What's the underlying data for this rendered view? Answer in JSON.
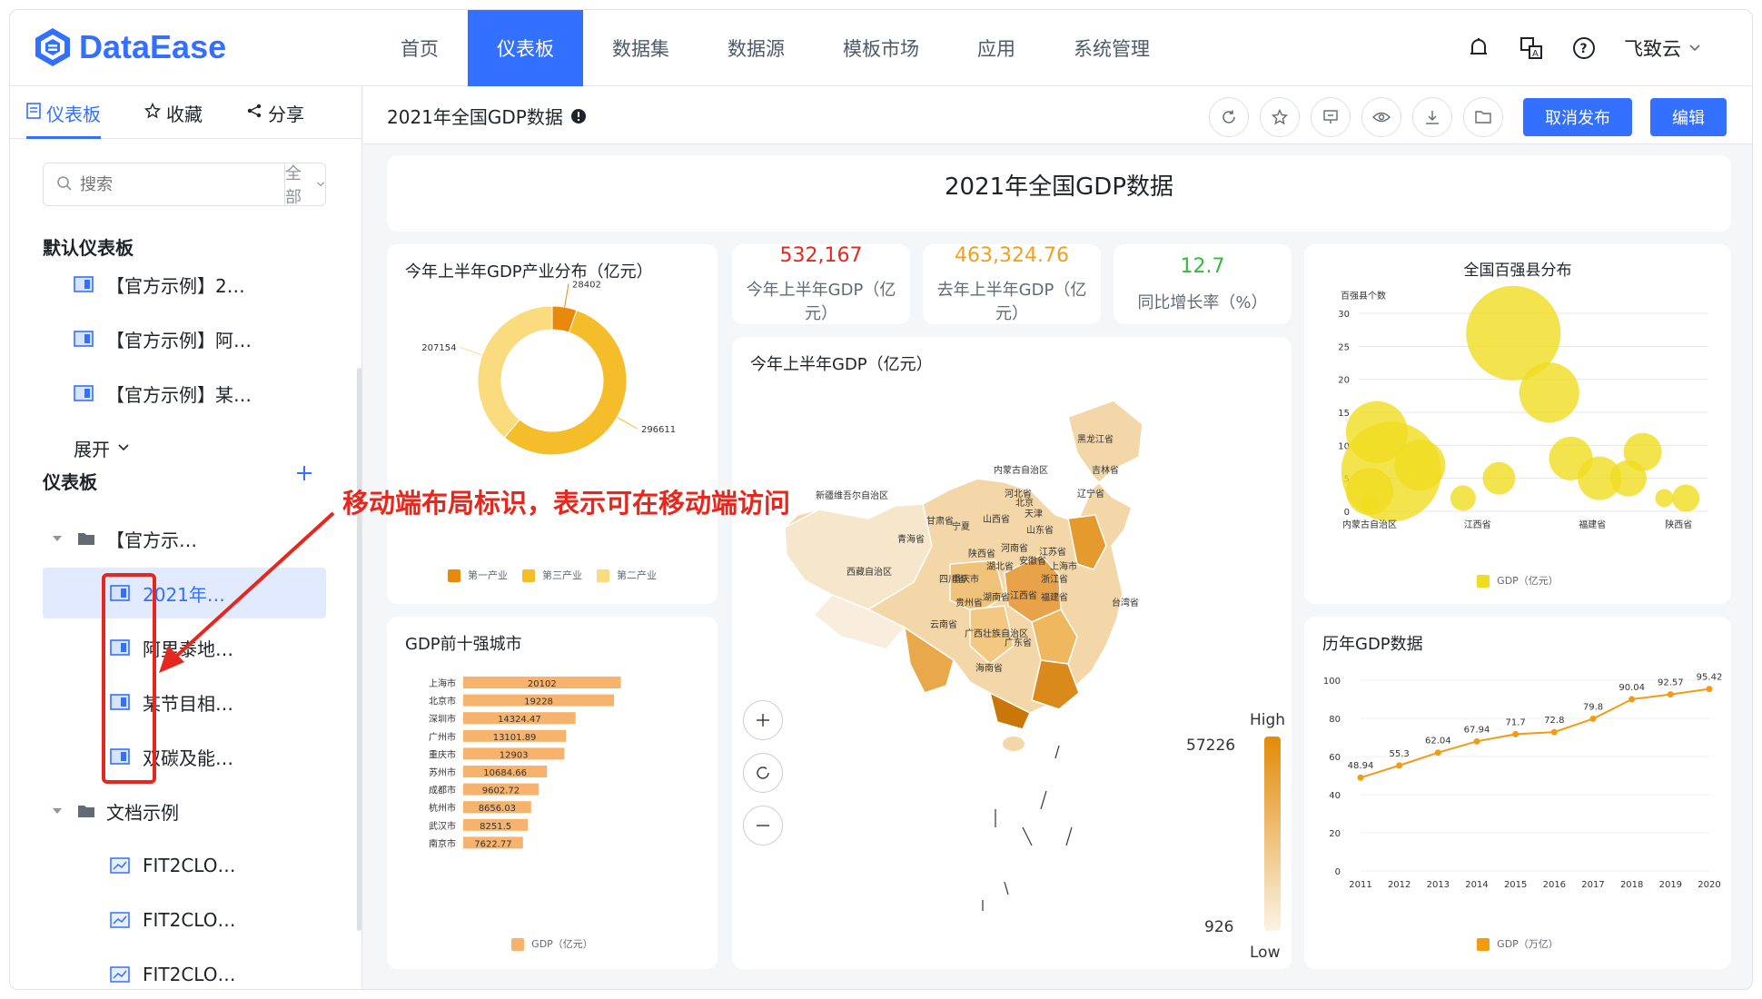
{
  "app": {
    "logo_text": "DataEase"
  },
  "nav": {
    "items": [
      "首页",
      "仪表板",
      "数据集",
      "数据源",
      "模板市场",
      "应用",
      "系统管理"
    ],
    "active_index": 1
  },
  "user": {
    "name": "飞致云"
  },
  "sidebar": {
    "tabs": [
      "仪表板",
      "收藏",
      "分享"
    ],
    "search_placeholder": "搜索",
    "filter_value": "全部",
    "default_title": "默认仪表板",
    "default_items": [
      "【官方示例】2…",
      "【官方示例】阿…",
      "【官方示例】某…"
    ],
    "expand_label": "展开",
    "dash_title": "仪表板",
    "folder1": "【官方示…",
    "folder1_items": [
      "2021年…",
      "阿里泰地…",
      "某节目相…",
      "双碳及能…"
    ],
    "folder2": "文档示例",
    "folder2_items": [
      "FIT2CLO…",
      "FIT2CLO…",
      "FIT2CLO…"
    ]
  },
  "dashboard": {
    "title": "2021年全国GDP数据",
    "buttons": {
      "cancel_publish": "取消发布",
      "edit": "编辑"
    },
    "header_title": "2021年全国GDP数据"
  },
  "annotation": {
    "text": "移动端布局标识，表示可在移动端访问"
  },
  "kpis": [
    {
      "value": "532,167",
      "label": "今年上半年GDP（亿元）",
      "color": "#e5281e"
    },
    {
      "value": "463,324.76",
      "label": "去年上半年GDP（亿元）",
      "color": "#f2a01b"
    },
    {
      "value": "12.7",
      "label": "同比增长率（%）",
      "color": "#2fbf3a"
    }
  ],
  "map": {
    "title": "今年上半年GDP（亿元）",
    "high_label": "High",
    "low_label": "Low",
    "max": "57226",
    "min": "926",
    "provinces": [
      "黑龙江省",
      "吉林省",
      "辽宁省",
      "内蒙古自治区",
      "新疆维吾尔自治区",
      "甘肃省",
      "青海省",
      "西藏自治区",
      "四川省",
      "云南省",
      "广西壮族自治区",
      "广东省",
      "海南省",
      "福建省",
      "浙江省",
      "上海市",
      "山东省",
      "河南省",
      "湖北省",
      "湖南省",
      "江西省",
      "贵州省",
      "重庆市",
      "山西省",
      "陕西省",
      "宁夏",
      "北京",
      "天津",
      "河北省",
      "安徽省",
      "江苏省",
      "台湾省"
    ]
  },
  "chart_data": [
    {
      "type": "pie",
      "title": "今年上半年GDP产业分布（亿元）",
      "categories": [
        "第一产业",
        "第三产业",
        "第二产业"
      ],
      "values": [
        28402,
        296611,
        207154
      ],
      "colors": [
        "#e8890c",
        "#f5bd29",
        "#fadb7e"
      ],
      "legend": "bottom"
    },
    {
      "type": "bar",
      "orientation": "horizontal",
      "title": "GDP前十强城市",
      "categories": [
        "上海市",
        "北京市",
        "深圳市",
        "广州市",
        "重庆市",
        "苏州市",
        "成都市",
        "杭州市",
        "武汉市",
        "南京市"
      ],
      "values": [
        20102,
        19228,
        14324.47,
        13101.89,
        12903,
        10684.66,
        9602.72,
        8656.03,
        8251.5,
        7622.77
      ],
      "series_name": "GDP（亿元）",
      "color": "#f7b26b",
      "legend": "bottom"
    },
    {
      "type": "scatter",
      "title": "全国百强县分布",
      "ylabel": "百强县个数",
      "ylim": [
        0,
        30
      ],
      "yticks": [
        0,
        5,
        10,
        15,
        20,
        25,
        30
      ],
      "x_labels": [
        "内蒙古自治区",
        "江西省",
        "福建省",
        "陕西省"
      ],
      "series_name": "GDP（亿元）",
      "points": [
        [
          0,
          1,
          10
        ],
        [
          0.1,
          12,
          34
        ],
        [
          0.3,
          6,
          55
        ],
        [
          0.7,
          7,
          28
        ],
        [
          1.3,
          2,
          14
        ],
        [
          1.8,
          5,
          18
        ],
        [
          2,
          27,
          52
        ],
        [
          2.5,
          18,
          33
        ],
        [
          2.8,
          8,
          24
        ],
        [
          3.2,
          5,
          24
        ],
        [
          3.6,
          5,
          20
        ],
        [
          3.8,
          9,
          21
        ],
        [
          4.1,
          2,
          10
        ],
        [
          4.4,
          2,
          15
        ],
        [
          0,
          3,
          26
        ]
      ],
      "color": "#f0dc1f",
      "legend": "bottom"
    },
    {
      "type": "line",
      "title": "历年GDP数据",
      "x": [
        "2011",
        "2012",
        "2013",
        "2014",
        "2015",
        "2016",
        "2017",
        "2018",
        "2019",
        "2020"
      ],
      "values": [
        48.94,
        55.3,
        62.04,
        67.94,
        71.7,
        72.8,
        79.8,
        90.04,
        92.57,
        95.42
      ],
      "series_name": "GDP（万亿）",
      "ylim": [
        0,
        100
      ],
      "yticks": [
        0,
        20,
        40,
        60,
        80,
        100
      ],
      "color": "#f29b13",
      "legend": "bottom"
    }
  ]
}
